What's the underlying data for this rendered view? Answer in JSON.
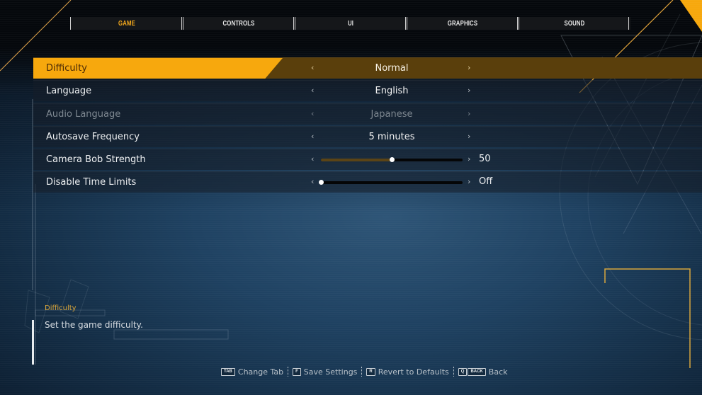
{
  "tabs": [
    {
      "label": "GAME",
      "active": true
    },
    {
      "label": "CONTROLS",
      "active": false
    },
    {
      "label": "UI",
      "active": false
    },
    {
      "label": "GRAPHICS",
      "active": false
    },
    {
      "label": "SOUND",
      "active": false
    }
  ],
  "settings": [
    {
      "label": "Difficulty",
      "value": "Normal",
      "type": "selector",
      "selected": true,
      "disabled": false
    },
    {
      "label": "Language",
      "value": "English",
      "type": "selector",
      "selected": false,
      "disabled": false
    },
    {
      "label": "Audio Language",
      "value": "Japanese",
      "type": "selector",
      "selected": false,
      "disabled": true
    },
    {
      "label": "Autosave Frequency",
      "value": "5 minutes",
      "type": "selector",
      "selected": false,
      "disabled": false
    },
    {
      "label": "Camera Bob Strength",
      "value": "50",
      "type": "slider",
      "level": 0.5,
      "selected": false,
      "disabled": false
    },
    {
      "label": "Disable Time Limits",
      "value": "Off",
      "type": "slider",
      "level": 0.0,
      "selected": false,
      "disabled": false
    }
  ],
  "arrows": {
    "left": "‹",
    "right": "›"
  },
  "description": {
    "title": "Difficulty",
    "text": "Set the game difficulty."
  },
  "footer": [
    {
      "keys": [
        "TAB"
      ],
      "label": "Change Tab"
    },
    {
      "keys": [
        "F"
      ],
      "label": "Save Settings"
    },
    {
      "keys": [
        "R"
      ],
      "label": "Revert to Defaults"
    },
    {
      "keys": [
        "Q",
        "BACK"
      ],
      "label": "Back"
    }
  ],
  "colors": {
    "accent": "#f7a80d",
    "accent_dark": "#5a3f0c",
    "tab_active": "#f2a81d",
    "background": "#1f4262"
  }
}
